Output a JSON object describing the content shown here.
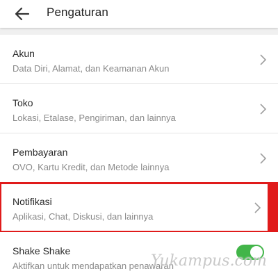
{
  "appbar": {
    "back_icon": "arrow-left-icon",
    "title": "Pengaturan"
  },
  "settings": {
    "items": [
      {
        "title": "Akun",
        "subtitle": "Data Diri, Alamat, dan Keamanan Akun",
        "icon": "chevron-right-icon"
      },
      {
        "title": "Toko",
        "subtitle": "Lokasi, Etalase, Pengiriman, dan lainnya",
        "icon": "chevron-right-icon"
      },
      {
        "title": "Pembayaran",
        "subtitle": "OVO, Kartu Kredit, dan Metode lainnya",
        "icon": "chevron-right-icon"
      },
      {
        "title": "Notifikasi",
        "subtitle": "Aplikasi, Chat, Diskusi, dan lainnya",
        "icon": "chevron-right-icon",
        "highlighted": true
      },
      {
        "title": "Shake Shake",
        "subtitle": "Aktifkan untuk mendapatkan penawaran",
        "toggle_on": true
      }
    ]
  },
  "watermark": "Yukampus.com",
  "colors": {
    "highlight": "#e01b1b",
    "toggle_on": "#42b549",
    "subtitle": "#8a8a8a"
  }
}
